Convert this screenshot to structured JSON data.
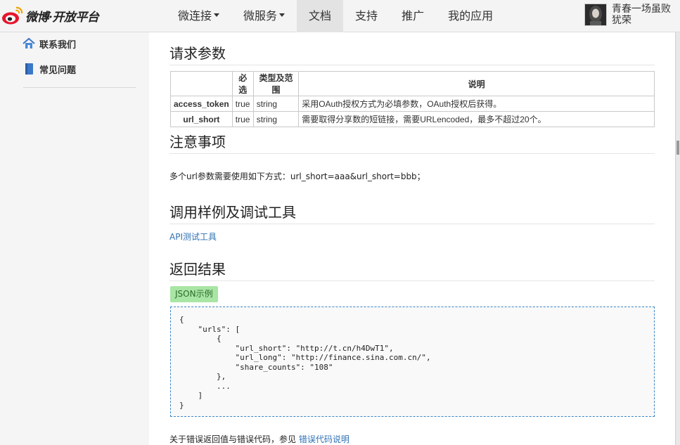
{
  "header": {
    "logo_text": "微博·开放平台",
    "nav": [
      {
        "label": "微连接",
        "has_caret": true
      },
      {
        "label": "微服务",
        "has_caret": true
      },
      {
        "label": "文档",
        "active": true
      },
      {
        "label": "支持"
      },
      {
        "label": "推广"
      },
      {
        "label": "我的应用"
      }
    ],
    "user_name": "青春一场虽败犹荣"
  },
  "sidebar": {
    "items": [
      {
        "label": "联系我们",
        "icon": "home-icon"
      },
      {
        "label": "常见问题",
        "icon": "book-icon"
      }
    ]
  },
  "sections": {
    "params": {
      "title": "请求参数",
      "columns": [
        "",
        "必选",
        "类型及范围",
        "说明"
      ],
      "rows": [
        {
          "name": "access_token",
          "required": "true",
          "type": "string",
          "desc": "采用OAuth授权方式为必填参数，OAuth授权后获得。"
        },
        {
          "name": "url_short",
          "required": "true",
          "type": "string",
          "desc": "需要取得分享数的短链接，需要URLencoded，最多不超过20个。"
        }
      ]
    },
    "notes": {
      "title": "注意事项",
      "text": "多个url参数需要使用如下方式：url_short=aaa&url_short=bbb；"
    },
    "tools": {
      "title": "调用样例及调试工具",
      "link": "API测试工具"
    },
    "result": {
      "title": "返回结果",
      "tab_label": "JSON示例",
      "code": "{\n    \"urls\": [\n        {\n            \"url_short\": \"http://t.cn/h4DwT1\",\n            \"url_long\": \"http://finance.sina.com.cn/\",\n            \"share_counts\": \"108\"\n        },\n        ...\n    ]\n}",
      "footer_text": "关于错误返回值与错误代码，参见",
      "footer_link": "错误代码说明"
    }
  },
  "colors": {
    "link": "#2f71b5",
    "tab_bg": "#a9e5a5",
    "code_border": "#3b86c6"
  }
}
